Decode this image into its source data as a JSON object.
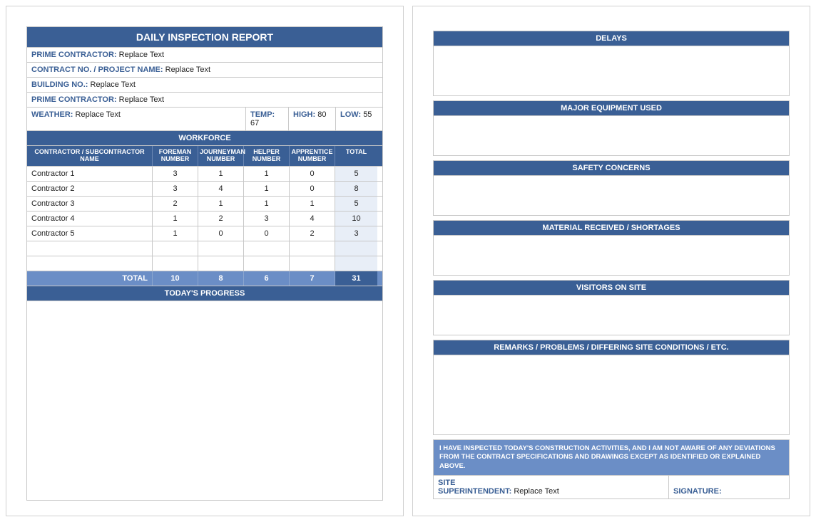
{
  "report": {
    "title": "DAILY INSPECTION REPORT",
    "fields": {
      "prime_contractor_label": "PRIME CONTRACTOR:",
      "prime_contractor_value": "Replace Text",
      "contract_no_label": "CONTRACT NO. / PROJECT NAME:",
      "contract_no_value": "Replace Text",
      "building_no_label": "BUILDING NO.:",
      "building_no_value": "Replace Text",
      "prime_contractor2_label": "PRIME CONTRACTOR:",
      "prime_contractor2_value": "Replace Text",
      "weather_label": "WEATHER:",
      "weather_value": "Replace Text",
      "temp_label": "TEMP:",
      "temp_value": "67",
      "high_label": "HIGH:",
      "high_value": "80",
      "low_label": "LOW:",
      "low_value": "55"
    },
    "workforce": {
      "heading": "WORKFORCE",
      "columns": {
        "name": "CONTRACTOR / SUBCONTRACTOR NAME",
        "foreman": "FOREMAN NUMBER",
        "journeyman": "JOURNEYMAN NUMBER",
        "helper": "HELPER NUMBER",
        "apprentice": "APPRENTICE NUMBER",
        "total": "TOTAL"
      },
      "rows": [
        {
          "name": "Contractor 1",
          "foreman": "3",
          "journeyman": "1",
          "helper": "1",
          "apprentice": "0",
          "total": "5"
        },
        {
          "name": "Contractor 2",
          "foreman": "3",
          "journeyman": "4",
          "helper": "1",
          "apprentice": "0",
          "total": "8"
        },
        {
          "name": "Contractor 3",
          "foreman": "2",
          "journeyman": "1",
          "helper": "1",
          "apprentice": "1",
          "total": "5"
        },
        {
          "name": "Contractor 4",
          "foreman": "1",
          "journeyman": "2",
          "helper": "3",
          "apprentice": "4",
          "total": "10"
        },
        {
          "name": "Contractor 5",
          "foreman": "1",
          "journeyman": "0",
          "helper": "0",
          "apprentice": "2",
          "total": "3"
        }
      ],
      "totals_label": "TOTAL",
      "totals": {
        "foreman": "10",
        "journeyman": "8",
        "helper": "6",
        "apprentice": "7",
        "total": "31"
      }
    },
    "progress_heading": "TODAY'S PROGRESS"
  },
  "page2": {
    "delays": "DELAYS",
    "equipment": "MAJOR EQUIPMENT USED",
    "safety": "SAFETY CONCERNS",
    "material": "MATERIAL RECEIVED / SHORTAGES",
    "visitors": "VISITORS ON SITE",
    "remarks": "REMARKS / PROBLEMS / DIFFERING SITE CONDITIONS / ETC.",
    "cert_text": "I HAVE INSPECTED TODAY'S CONSTRUCTION ACTIVITIES, AND I AM NOT AWARE OF ANY DEVIATIONS FROM THE CONTRACT SPECIFICATIONS AND DRAWINGS EXCEPT AS IDENTIFIED OR EXPLAINED ABOVE.",
    "super_label1": "SITE",
    "super_label2": "SUPERINTENDENT:",
    "super_value": "Replace Text",
    "signature_label": "SIGNATURE:"
  }
}
